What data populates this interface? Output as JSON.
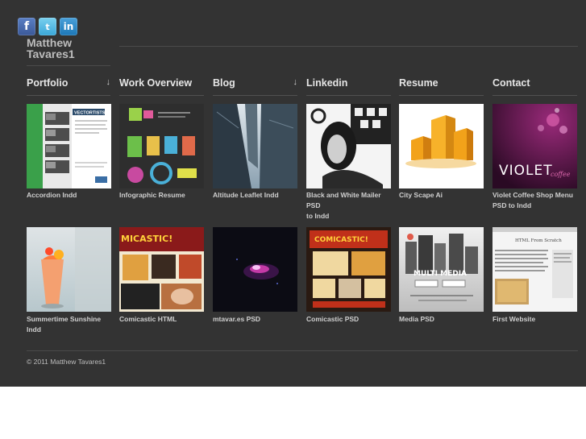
{
  "social": {
    "facebook_glyph": "f",
    "twitter_glyph": "t",
    "linkedin_glyph": "in"
  },
  "brand": {
    "line1": "Matthew",
    "line2": "Tavares1"
  },
  "nav": [
    {
      "label": "Portfolio",
      "arrow": "↓"
    },
    {
      "label": "Work Overview"
    },
    {
      "label": "Blog",
      "arrow": "↓"
    },
    {
      "label": "Linkedin"
    },
    {
      "label": "Resume"
    },
    {
      "label": "Contact"
    }
  ],
  "portfolio": [
    {
      "line1": "Accordion Indd",
      "line2": "",
      "thumb_label": "VECTORTISTS"
    },
    {
      "line1": "Infographic Resume",
      "line2": ""
    },
    {
      "line1": "Altitude Leaflet Indd",
      "line2": ""
    },
    {
      "line1": "Black and White Mailer PSD",
      "line2": "to Indd"
    },
    {
      "line1": "City Scape Ai",
      "line2": ""
    },
    {
      "line1": "Violet Coffee Shop Menu",
      "line2": "PSD to Indd",
      "thumb_label": "VIOLET",
      "thumb_sub": "coffee"
    },
    {
      "line1": "Summertime Sunshine",
      "line2": "Indd"
    },
    {
      "line1": "Comicastic HTML",
      "line2": "",
      "thumb_label": "MICASTIC!"
    },
    {
      "line1": "mtavar.es PSD",
      "line2": ""
    },
    {
      "line1": "Comicastic PSD",
      "line2": "",
      "thumb_label": "COMICASTIC!"
    },
    {
      "line1": "Media PSD",
      "line2": "",
      "thumb_label": "MULTI MEDIA"
    },
    {
      "line1": "First Website",
      "line2": "",
      "thumb_label": "HTML From Scratch"
    }
  ],
  "footer": {
    "copyright": "© 2011 Matthew Tavares1"
  },
  "colors": {
    "background": "#333333",
    "text": "#e6e6e6",
    "caption": "#cfcfcf"
  }
}
